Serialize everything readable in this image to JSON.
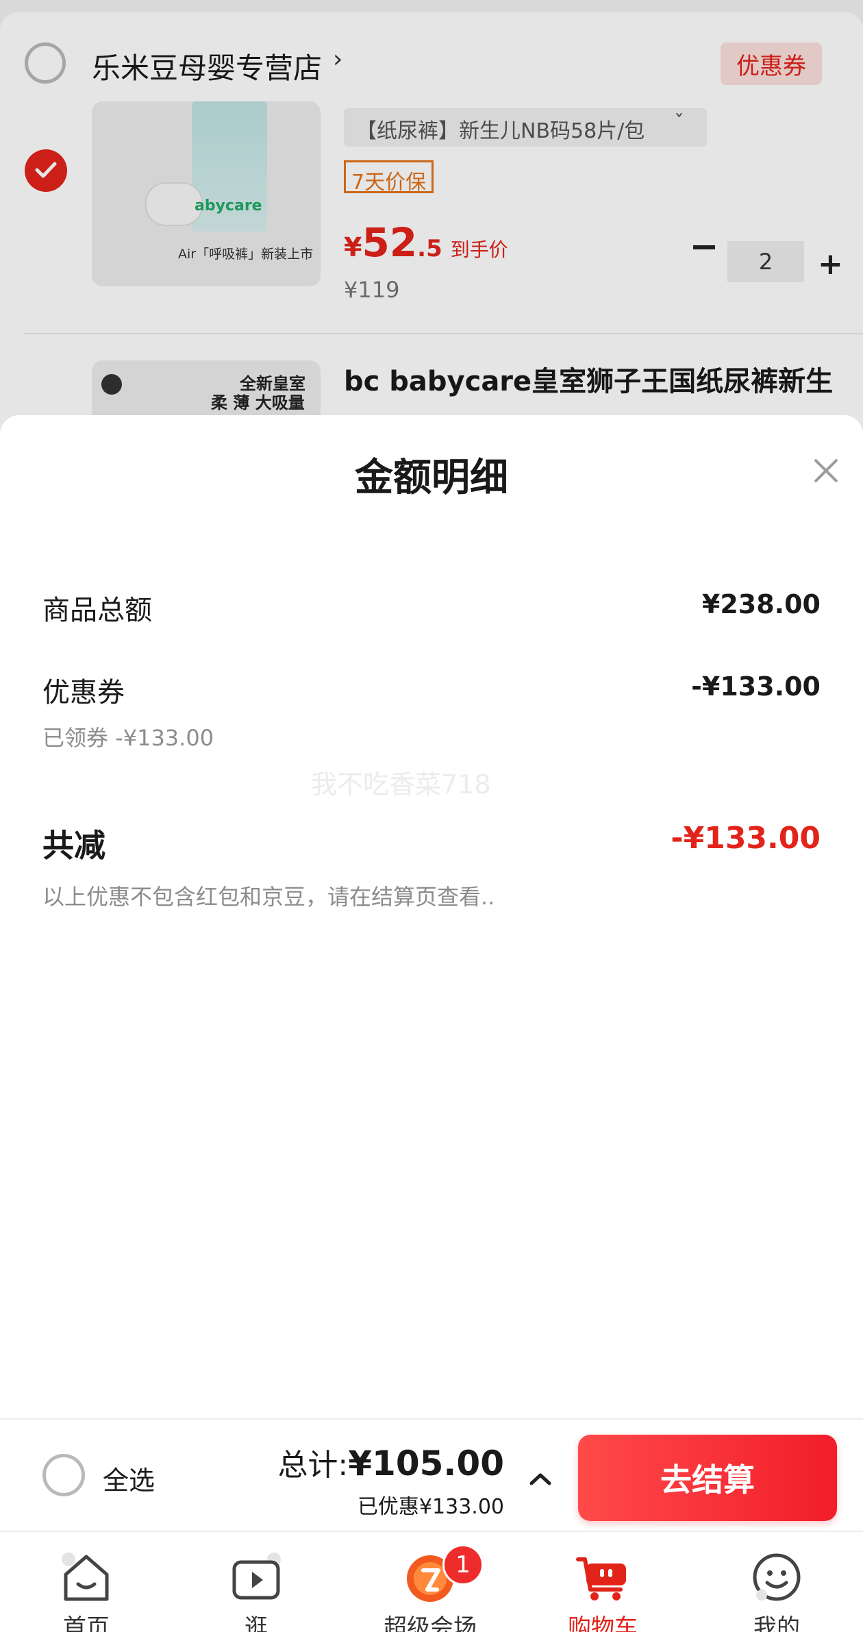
{
  "store": {
    "name": "乐米豆母婴专营店",
    "chevron": "›",
    "coupon_label": "优惠券"
  },
  "product1": {
    "image_caption": "Air「呼吸裤」新装上市",
    "image_brand": "abycare",
    "variant": "【纸尿裤】新生儿NB码58片/包",
    "variant_chevron": "ˇ",
    "price_guard": "7天价保",
    "price_currency": "¥",
    "price_int": "52",
    "price_dec": ".5",
    "price_label": "到手价",
    "original_price": "¥119",
    "quantity": "2",
    "qty_minus": "−",
    "qty_plus": "+"
  },
  "product2": {
    "title": "bc babycare皇室狮子王国纸尿裤新生",
    "image_badge_line1": "全新皇室",
    "image_badge_line2": "柔 薄 大吸量"
  },
  "sheet": {
    "title": "金额明细",
    "rows": [
      {
        "label": "商品总额",
        "value": "¥238.00"
      },
      {
        "label": "优惠券",
        "value": "-¥133.00",
        "sub": "已领券 -¥133.00"
      }
    ],
    "total_label": "共减",
    "total_value": "-¥133.00",
    "note": "以上优惠不包含红包和京豆，请在结算页查看..",
    "watermark": "我不吃香菜718"
  },
  "checkout": {
    "select_all": "全选",
    "total_label": "总计:",
    "total_value": "¥105.00",
    "saved": "已优惠¥133.00",
    "button": "去结算"
  },
  "tabs": [
    {
      "label": "首页",
      "icon": "home-icon"
    },
    {
      "label": "逛",
      "icon": "video-icon"
    },
    {
      "label": "超级会场",
      "icon": "super-venue-icon",
      "badge": "1"
    },
    {
      "label": "购物车",
      "icon": "cart-icon",
      "active": true
    },
    {
      "label": "我的",
      "icon": "profile-icon"
    }
  ],
  "colors": {
    "accent": "#e2231a",
    "price_guard": "#e2731a",
    "muted": "#8c8c8c"
  }
}
